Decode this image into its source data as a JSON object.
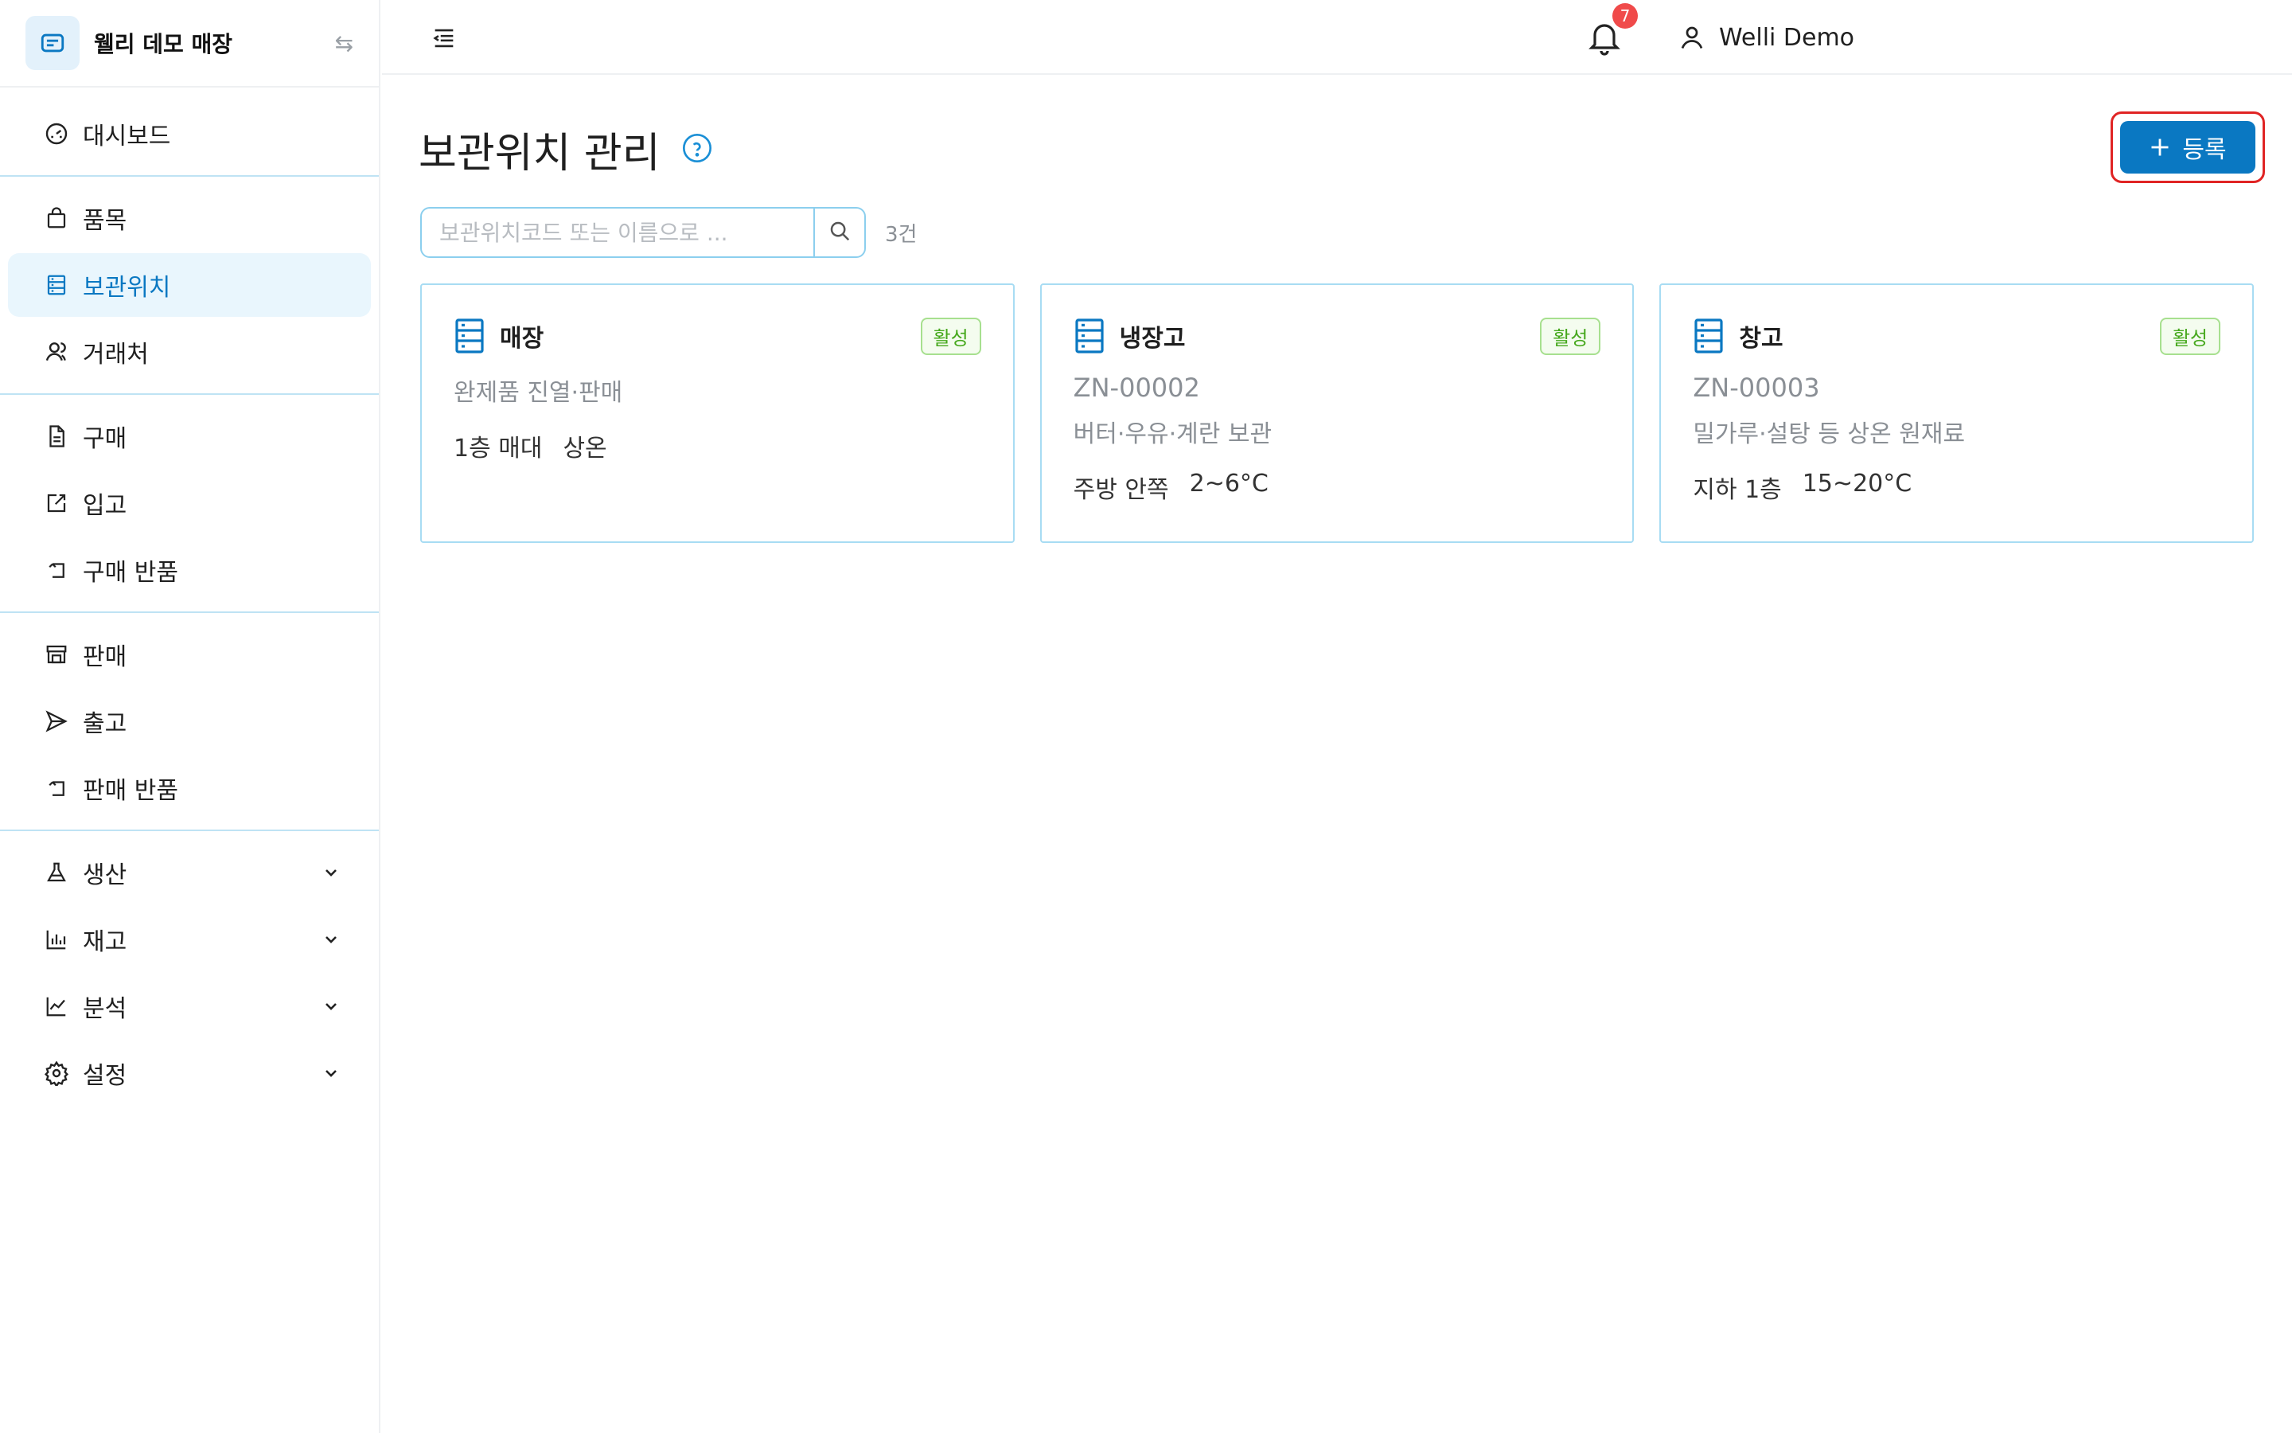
{
  "brand": {
    "name": "웰리 데모 매장",
    "swap_icon": "swap-icon"
  },
  "nav": [
    {
      "group": 1,
      "items": [
        {
          "key": "dashboard",
          "label": "대시보드",
          "icon": "gauge-icon"
        }
      ]
    },
    {
      "group": 2,
      "items": [
        {
          "key": "items",
          "label": "품목",
          "icon": "bag-icon"
        },
        {
          "key": "locations",
          "label": "보관위치",
          "icon": "storage-icon",
          "active": true
        },
        {
          "key": "partners",
          "label": "거래처",
          "icon": "users-icon"
        }
      ]
    },
    {
      "group": 3,
      "items": [
        {
          "key": "purchase",
          "label": "구매",
          "icon": "document-icon"
        },
        {
          "key": "inbound",
          "label": "입고",
          "icon": "edit-square-icon"
        },
        {
          "key": "purchase-return",
          "label": "구매 반품",
          "icon": "return-icon"
        }
      ]
    },
    {
      "group": 4,
      "items": [
        {
          "key": "sales",
          "label": "판매",
          "icon": "store-icon"
        },
        {
          "key": "outbound",
          "label": "출고",
          "icon": "send-icon"
        },
        {
          "key": "sales-return",
          "label": "판매 반품",
          "icon": "return-icon"
        }
      ]
    },
    {
      "group": 5,
      "items": [
        {
          "key": "production",
          "label": "생산",
          "icon": "flask-icon",
          "expandable": true
        },
        {
          "key": "inventory",
          "label": "재고",
          "icon": "bar-chart-icon",
          "expandable": true
        },
        {
          "key": "analytics",
          "label": "분석",
          "icon": "line-chart-icon",
          "expandable": true
        },
        {
          "key": "settings",
          "label": "설정",
          "icon": "gear-icon",
          "expandable": true
        }
      ]
    }
  ],
  "topbar": {
    "notifications_count": "7",
    "user_name": "Welli Demo"
  },
  "page": {
    "title": "보관위치 관리",
    "add_label": "등록",
    "search_placeholder": "보관위치코드 또는 이름으로 ...",
    "count_text": "3건"
  },
  "locations": [
    {
      "name": "매장",
      "status": "활성",
      "code": "",
      "description": "완제품 진열·판매",
      "place": "1층 매대",
      "temperature": "상온"
    },
    {
      "name": "냉장고",
      "status": "활성",
      "code": "ZN-00002",
      "description": "버터·우유·계란 보관",
      "place": "주방 안쪽",
      "temperature": "2~6°C"
    },
    {
      "name": "창고",
      "status": "활성",
      "code": "ZN-00003",
      "description": "밀가루·설탕 등 상온 원재료",
      "place": "지하 1층",
      "temperature": "15~20°C"
    }
  ],
  "colors": {
    "accent": "#0a78c2",
    "active_bg": "#e9f6fd",
    "badge_green": "#46a81d",
    "alert_red": "#f04a4a",
    "highlight_border": "#e02424"
  }
}
